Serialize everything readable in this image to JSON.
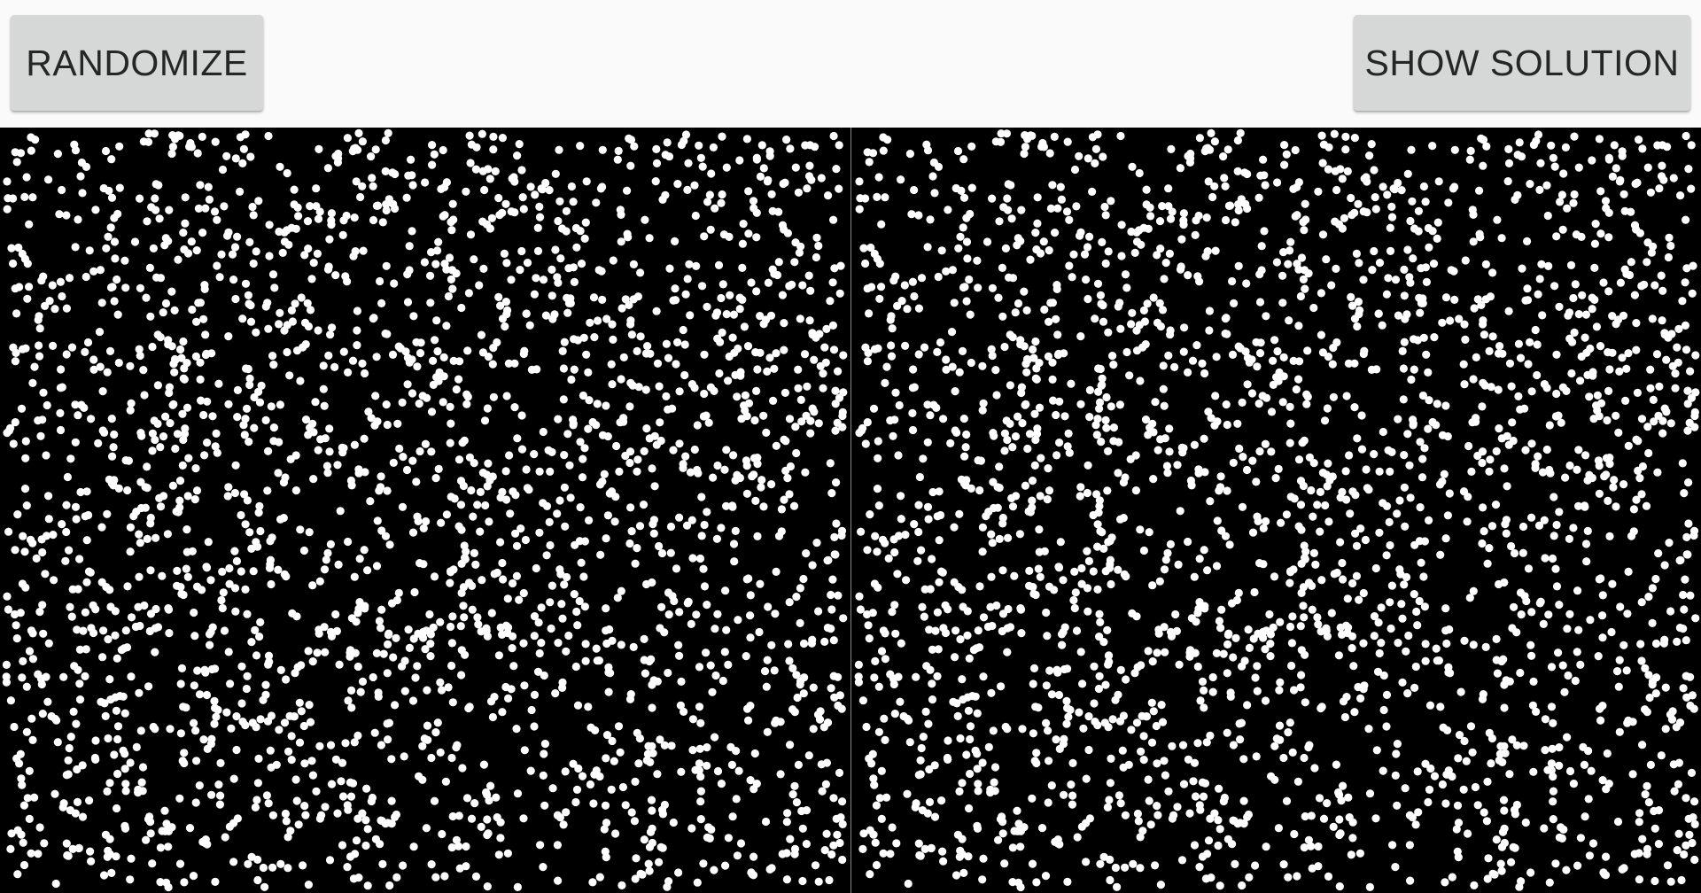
{
  "toolbar": {
    "randomize_label": "RANDOMIZE",
    "show_solution_label": "SHOW SOLUTION"
  },
  "stereogram": {
    "background_color": "#000000",
    "dot_color": "#ffffff",
    "dot_count": 2300,
    "seed": 20240611
  }
}
